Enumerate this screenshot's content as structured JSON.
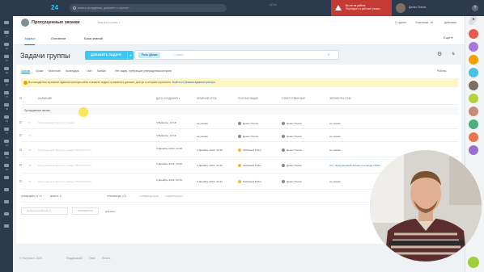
{
  "topbar": {
    "logo": "24",
    "search_placeholder": "искать сотрудника, документ, и прочее...",
    "clock": "12:34",
    "alert_title": "Вы не на работе",
    "alert_text": "Перейдите в рабочий режим",
    "user_name": "Денис Попов"
  },
  "sidebar": {
    "labels": [
      "ЧТ",
      "ДИ",
      "ТЛ",
      "ЗД",
      "КА",
      "ГР",
      "ЛИ",
      "СЕ",
      "ОТ",
      "ЕМ",
      "СД",
      "ЗИ"
    ]
  },
  "header": {
    "group_name": "Пропущенные звонки",
    "group_sub": "Запросы в группу ▾",
    "links": [
      "О группе",
      "Участники: 18",
      "Действия"
    ],
    "tabs": [
      "Задачи",
      "Основное",
      "База знаний"
    ],
    "more": "Ещё ▾"
  },
  "toolbar": {
    "title": "Задачи группы",
    "add_button": "ДОБАВИТЬ ЗАДАЧУ",
    "filter_chip": "Роль: Делаю",
    "filter_placeholder": "+ поиск"
  },
  "view_tabs": [
    "Список",
    "Сроки",
    "Мой план",
    "Календарь",
    "Гант",
    "Канбан",
    "Нет задач, требующих утверждения/контроля"
  ],
  "robots": "Роботы",
  "banner": {
    "text": "Вы находитесь в режиме администратора сайта и можете видеть и изменять данные, доступ к которым ограничен.",
    "link": "Выйти из режима администратора"
  },
  "table": {
    "columns": [
      "НАЗВАНИЕ",
      "ДАТА СОЗДАНИЯ ▾",
      "КРАЙНИЙ СРОК",
      "ПОСТАНОВЩИК",
      "ОТВЕТСТВЕННЫЙ",
      "ЭЛЕМЕНТЫ CRM"
    ],
    "group_label": "Пропущенные звонки",
    "rows": [
      {
        "id": "71",
        "title": "Пропущенный звонок с номера",
        "created": "3 Февраль, 16:18",
        "deadline": "не указан",
        "author": "Денис Попов",
        "author_robot": false,
        "responsible": "Денис Попов",
        "crm": "не указан"
      },
      {
        "id": "70",
        "title": "...",
        "created": "3 Февраль, 16:16",
        "deadline": "не указан",
        "author": "Денис Попов",
        "author_robot": false,
        "responsible": "Денис Попов",
        "crm": "не указан"
      },
      {
        "id": "56",
        "title": "Пропущенный звонок с номера 79XXXXXXXX",
        "created": "3 Декабрь 2019, 22:48",
        "deadline": "3 Декабрь 2019, 22:48",
        "author": "Любимый Робот",
        "author_robot": true,
        "responsible": "Денис Попов",
        "crm": "не указан"
      },
      {
        "id": "55",
        "title": "Пропущенный звонок с номера 79XXXXXXXX",
        "created": "3 Декабрь 2019, 22:40",
        "deadline": "3 Декабрь 2019, 22:40",
        "author": "Любимый Робот",
        "author_robot": true,
        "responsible": "Денис Попов",
        "crm": "Что: Пропущенный звонок от номера 79(XX"
      },
      {
        "id": "54",
        "title": "Пропущенный звонок с номера 79XXXXXXXX",
        "created": "3 Декабрь 2019, 22:33",
        "deadline": "3 Декабрь 2019, 22:33",
        "author": "Любимый Робот",
        "author_robot": true,
        "responsible": "Денис Попов",
        "crm": "не указан"
      }
    ]
  },
  "footer": {
    "marked": "ОТМЕЧЕНО: 0 / 5",
    "total": "ВСЕГО: 5",
    "pages": "СТРАНИЦЫ: 1 ▾",
    "prev": "< ПРЕДЫДУЩАЯ",
    "next": "СЛЕДУЮЩАЯ >",
    "action_select": "выберите действие ▾",
    "apply": "ПРИМЕНИТЬ",
    "for_all": "для всех"
  },
  "copyright": {
    "text": "© «Битрикс», 2020",
    "links": [
      "Поддержка24",
      "Тема",
      "Печать"
    ]
  }
}
